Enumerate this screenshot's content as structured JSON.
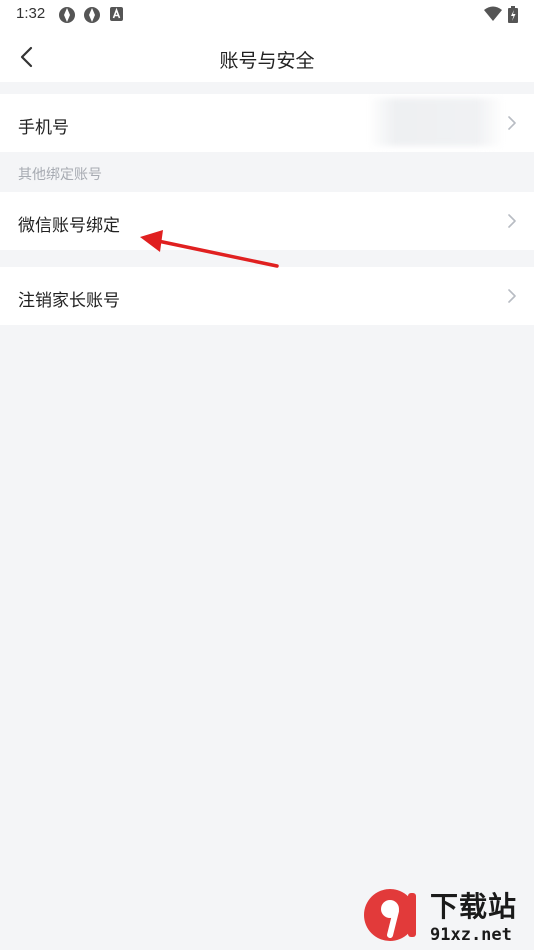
{
  "status_bar": {
    "time": "1:32",
    "left_icons": [
      "app-notification-icon",
      "app-notification-icon",
      "a-badge-icon"
    ],
    "right_icons": [
      "wifi-icon",
      "battery-charging-icon"
    ]
  },
  "header": {
    "title": "账号与安全",
    "back_icon": "chevron-left-icon"
  },
  "rows": {
    "phone": {
      "label": "手机号",
      "value": ""
    },
    "section_other": "其他绑定账号",
    "wechat": {
      "label": "微信账号绑定"
    },
    "cancel": {
      "label": "注销家长账号"
    }
  },
  "annotation": {
    "color": "#e02020"
  },
  "watermark": {
    "brand": "下载站",
    "url": "91xz.net",
    "logo_text": "9"
  },
  "colors": {
    "background": "#f4f5f7",
    "surface": "#ffffff",
    "section_text": "#a7abb2",
    "chevron": "#b8bcc3",
    "watermark_accent": "#e23a3a"
  }
}
